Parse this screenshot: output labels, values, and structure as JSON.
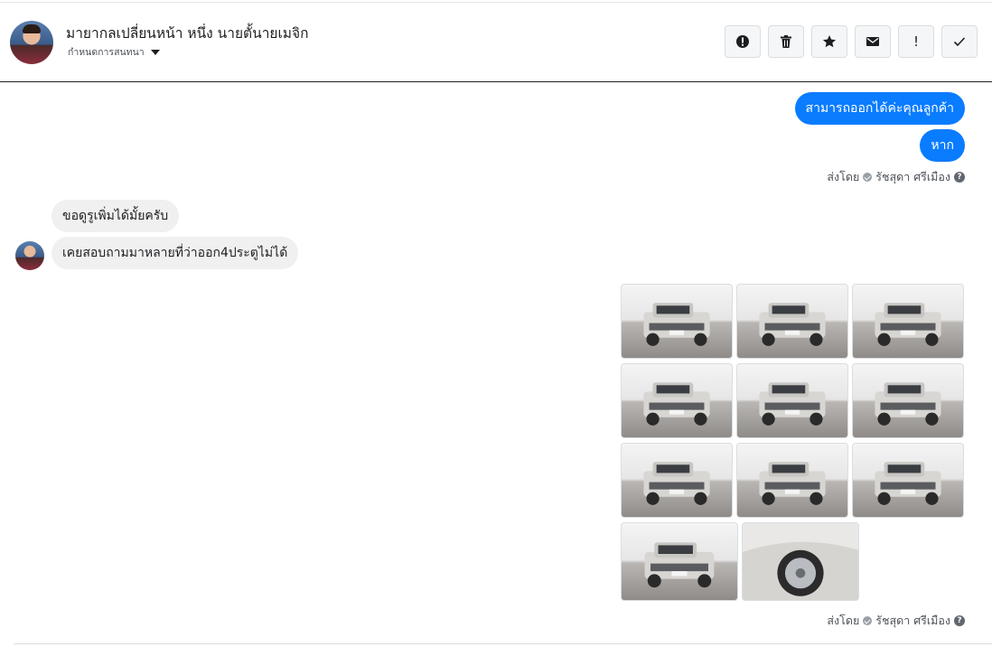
{
  "header": {
    "title": "มายากลเปลี่ยนหน้า หนึ่ง นายตั้นายเมจิก",
    "subtitle": "กำหนดการสนทนา",
    "toolbar": [
      {
        "icon": "alert-circle-icon"
      },
      {
        "icon": "trash-icon"
      },
      {
        "icon": "star-icon"
      },
      {
        "icon": "envelope-icon"
      },
      {
        "icon": "exclamation-icon",
        "label": "!"
      },
      {
        "icon": "check-icon"
      }
    ]
  },
  "messages": {
    "out_1": "สามารถออกได้ค่ะคุณลูกค้า",
    "out_2": "หาก",
    "sent_by_1": {
      "prefix": "ส่งโดย",
      "name": "รัชสุดา ศรีเมือง"
    },
    "in_1": "ขอดูรูเพิ่มได้มั้ยครับ",
    "in_2": "เคยสอบถามมาหลายที่ว่าออก4ประตูไม่ได้",
    "sent_by_2": {
      "prefix": "ส่งโดย",
      "name": "รัชสุดา ศรีเมือง"
    }
  },
  "photos": {
    "count": 11,
    "subject": "silver pickup truck"
  },
  "colors": {
    "accent": "#0a7cff",
    "incoming_bubble": "#f0f0f0"
  }
}
